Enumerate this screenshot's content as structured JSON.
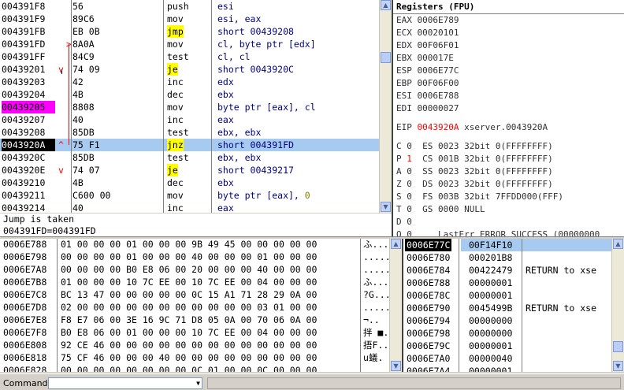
{
  "disasm": {
    "rows": [
      {
        "addr": "004391F8",
        "hex": "56",
        "mnem": "push",
        "ops": "esi",
        "style": "normal",
        "marker": ""
      },
      {
        "addr": "004391F9",
        "hex": "89C6",
        "mnem": "mov",
        "ops": "esi, eax",
        "style": "normal",
        "marker": ""
      },
      {
        "addr": "004391FB",
        "hex": "EB 0B",
        "mnem": "jmp",
        "ops": "short 00439208",
        "style": "jump",
        "marker": ""
      },
      {
        "addr": "004391FD",
        "hex": "8A0A",
        "mnem": "mov",
        "ops": "cl, byte ptr [edx]",
        "style": "normal",
        "marker": "start"
      },
      {
        "addr": "004391FF",
        "hex": "84C9",
        "mnem": "test",
        "ops": "cl, cl",
        "style": "normal",
        "marker": ""
      },
      {
        "addr": "00439201",
        "hex": "74 09",
        "mnem": "je",
        "ops": "short 0043920C",
        "style": "jump",
        "marker": "down"
      },
      {
        "addr": "00439203",
        "hex": "42",
        "mnem": "inc",
        "ops": "edx",
        "style": "normal",
        "marker": ""
      },
      {
        "addr": "00439204",
        "hex": "4B",
        "mnem": "dec",
        "ops": "ebx",
        "style": "normal",
        "marker": ""
      },
      {
        "addr": "00439205",
        "hex": "8808",
        "mnem": "mov",
        "ops": "byte ptr [eax], cl",
        "style": "normal",
        "marker": "",
        "addr_hl": "magenta"
      },
      {
        "addr": "00439207",
        "hex": "40",
        "mnem": "inc",
        "ops": "eax",
        "style": "normal",
        "marker": ""
      },
      {
        "addr": "00439208",
        "hex": "85DB",
        "mnem": "test",
        "ops": "ebx, ebx",
        "style": "normal",
        "marker": ""
      },
      {
        "addr": "0043920A",
        "hex": "75 F1",
        "mnem": "jnz",
        "ops": "short 004391FD",
        "style": "jump",
        "marker": "up",
        "addr_hl": "black",
        "selected": true
      },
      {
        "addr": "0043920C",
        "hex": "85DB",
        "mnem": "test",
        "ops": "ebx, ebx",
        "style": "normal",
        "marker": ""
      },
      {
        "addr": "0043920E",
        "hex": "74 07",
        "mnem": "je",
        "ops": "short 00439217",
        "style": "jump",
        "marker": "down"
      },
      {
        "addr": "00439210",
        "hex": "4B",
        "mnem": "dec",
        "ops": "ebx",
        "style": "normal",
        "marker": ""
      },
      {
        "addr": "00439211",
        "hex": "C600 00",
        "mnem": "mov",
        "ops": "byte ptr [eax], ",
        "ops_tail": "0",
        "style": "normal",
        "marker": ""
      },
      {
        "addr": "00439214",
        "hex": "40",
        "mnem": "inc",
        "ops": "eax",
        "style": "normal",
        "marker": ""
      }
    ]
  },
  "info": {
    "line1": "Jump is taken",
    "line2": "004391FD=004391FD"
  },
  "registers": {
    "title": "Registers (FPU)",
    "regs": [
      {
        "name": "EAX",
        "value": "0006E789",
        "note": ""
      },
      {
        "name": "ECX",
        "value": "00020101",
        "note": ""
      },
      {
        "name": "EDX",
        "value": "00F06F01",
        "note": ""
      },
      {
        "name": "EBX",
        "value": "000017E",
        "note": ""
      },
      {
        "name": "ESP",
        "value": "0006E77C",
        "note": ""
      },
      {
        "name": "EBP",
        "value": "00F06F00",
        "note": ""
      },
      {
        "name": "ESI",
        "value": "0006E788",
        "note": ""
      },
      {
        "name": "EDI",
        "value": "00000027",
        "note": ""
      }
    ],
    "eip": {
      "name": "EIP",
      "value": "0043920A",
      "note": "xserver.0043920A"
    },
    "flags": [
      {
        "flag": "C",
        "val": "0",
        "seg": "ES",
        "sel": "0023",
        "desc": "32bit 0(FFFFFFFF)",
        "red": false
      },
      {
        "flag": "P",
        "val": "1",
        "seg": "CS",
        "sel": "001B",
        "desc": "32bit 0(FFFFFFFF)",
        "red": true
      },
      {
        "flag": "A",
        "val": "0",
        "seg": "SS",
        "sel": "0023",
        "desc": "32bit 0(FFFFFFFF)",
        "red": false
      },
      {
        "flag": "Z",
        "val": "0",
        "seg": "DS",
        "sel": "0023",
        "desc": "32bit 0(FFFFFFFF)",
        "red": false
      },
      {
        "flag": "S",
        "val": "0",
        "seg": "FS",
        "sel": "003B",
        "desc": "32bit 7FFDD000(FFF)",
        "red": false
      },
      {
        "flag": "T",
        "val": "0",
        "seg": "GS",
        "sel": "0000",
        "desc": "NULL",
        "red": false
      },
      {
        "flag": "D",
        "val": "0",
        "seg": "",
        "sel": "",
        "desc": "",
        "red": false
      },
      {
        "flag": "O",
        "val": "0",
        "seg": "",
        "sel": "",
        "desc": "LastErr ERROR_SUCCESS (00000000",
        "red": false
      }
    ]
  },
  "dump": {
    "rows": [
      {
        "addr": "0006E788",
        "hex": "01 00 00 00 01 00 00 00 9B 49 45 00 00 00 00 00",
        "ascii": "ふ....."
      },
      {
        "addr": "0006E798",
        "hex": "00 00 00 00 01 00 00 00 40 00 00 00 01 00 00 00",
        "ascii": "......."
      },
      {
        "addr": "0006E7A8",
        "hex": "00 00 00 00 B0 E8 06 00 20 00 00 00 40 00 00 00",
        "ascii": "......."
      },
      {
        "addr": "0006E7B8",
        "hex": "01 00 00 00 10 7C EE 00 10 7C EE 00 04 00 00 00",
        "ascii": "ふ...."
      },
      {
        "addr": "0006E7C8",
        "hex": "BC 13 47 00 00 00 00 00 0C 15 A1 71 28 29 0A 00",
        "ascii": "?G...."
      },
      {
        "addr": "0006E7D8",
        "hex": "02 00 00 00 00 00 00 00 00 00 00 00 03 01 00 00",
        "ascii": "......"
      },
      {
        "addr": "0006E7E8",
        "hex": "F8 E7 06 00 3E 16 9C 71 D8 05 0A 00 70 06 0A 00",
        "ascii": "¬.."
      },
      {
        "addr": "0006E7F8",
        "hex": "B0 E8 06 00 01 00 00 00 10 7C EE 00 04 00 00 00",
        "ascii": "拌 ■."
      },
      {
        "addr": "0006E808",
        "hex": "92 CE 46 00 00 00 00 00 00 00 00 00 00 00 00 00",
        "ascii": "捂F.."
      },
      {
        "addr": "0006E818",
        "hex": "75 CF 46 00 00 00 40 00 00 00 00 00 00 00 00 00",
        "ascii": "u蟻."
      },
      {
        "addr": "0006E828",
        "hex": "00 00 00 00 00 00 00 00 0C 01 00 00 0C 00 00 00",
        "ascii": "....."
      }
    ]
  },
  "stack": {
    "rows": [
      {
        "addr": "0006E77C",
        "value": "00F14F10",
        "comment": "",
        "selected": true
      },
      {
        "addr": "0006E780",
        "value": "000201B8",
        "comment": ""
      },
      {
        "addr": "0006E784",
        "value": "00422479",
        "comment": "RETURN to xse"
      },
      {
        "addr": "0006E788",
        "value": "00000001",
        "comment": ""
      },
      {
        "addr": "0006E78C",
        "value": "00000001",
        "comment": ""
      },
      {
        "addr": "0006E790",
        "value": "0045499B",
        "comment": "RETURN to xse"
      },
      {
        "addr": "0006E794",
        "value": "00000000",
        "comment": ""
      },
      {
        "addr": "0006E798",
        "value": "00000000",
        "comment": ""
      },
      {
        "addr": "0006E79C",
        "value": "00000001",
        "comment": ""
      },
      {
        "addr": "0006E7A0",
        "value": "00000040",
        "comment": ""
      },
      {
        "addr": "0006E7A4",
        "value": "00000001",
        "comment": ""
      }
    ]
  },
  "command": {
    "label": "Command",
    "value": ""
  },
  "icons": {
    "scroll_up": "▲",
    "scroll_down": "▼",
    "dropdown": "▼"
  }
}
